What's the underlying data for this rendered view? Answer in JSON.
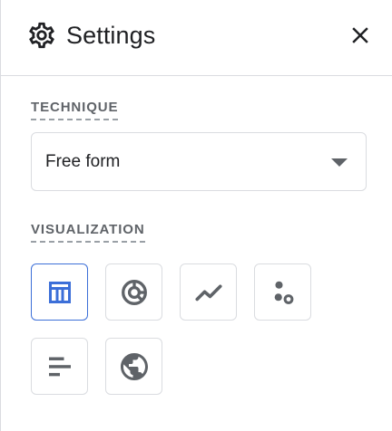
{
  "header": {
    "title": "Settings",
    "icon": "gear-icon",
    "close_icon": "close-icon"
  },
  "technique": {
    "label": "TECHNIQUE",
    "selected": "Free form"
  },
  "visualization": {
    "label": "VISUALIZATION",
    "selected": "table",
    "options": [
      {
        "name": "table",
        "icon": "table-icon"
      },
      {
        "name": "donut",
        "icon": "donut-chart-icon"
      },
      {
        "name": "line",
        "icon": "line-chart-icon"
      },
      {
        "name": "scatter",
        "icon": "scatter-chart-icon"
      },
      {
        "name": "bar",
        "icon": "bar-chart-icon"
      },
      {
        "name": "geo",
        "icon": "globe-icon"
      }
    ]
  },
  "colors": {
    "accent": "#3c6fd8",
    "icon": "#5f6368",
    "border": "#dadce0"
  }
}
